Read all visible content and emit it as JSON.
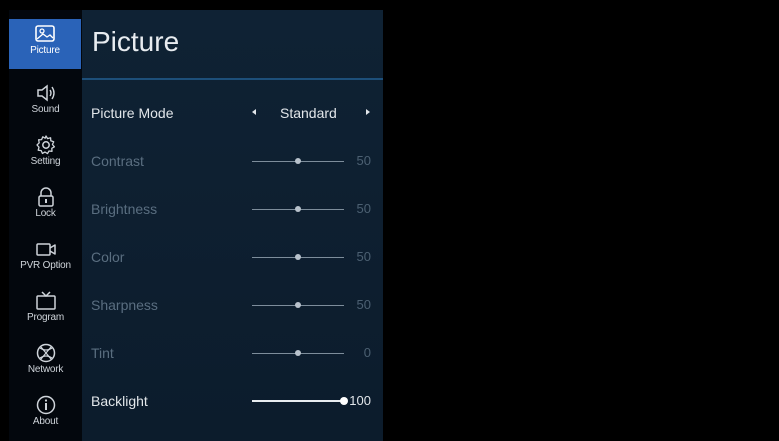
{
  "sidebar": {
    "items": [
      {
        "label": "Picture",
        "icon": "picture-icon",
        "active": true
      },
      {
        "label": "Sound",
        "icon": "speaker-icon",
        "active": false
      },
      {
        "label": "Setting",
        "icon": "gear-icon",
        "active": false
      },
      {
        "label": "Lock",
        "icon": "lock-icon",
        "active": false
      },
      {
        "label": "PVR Option",
        "icon": "video-camera-icon",
        "active": false
      },
      {
        "label": "Program",
        "icon": "tv-icon",
        "active": false
      },
      {
        "label": "Network",
        "icon": "globe-icon",
        "active": false
      },
      {
        "label": "About",
        "icon": "info-icon",
        "active": false
      }
    ]
  },
  "menu": {
    "title": "Picture",
    "picture_mode": {
      "label": "Picture Mode",
      "value": "Standard"
    },
    "sliders": [
      {
        "label": "Contrast",
        "value": "50",
        "fraction": 0.5,
        "enabled": false
      },
      {
        "label": "Brightness",
        "value": "50",
        "fraction": 0.5,
        "enabled": false
      },
      {
        "label": "Color",
        "value": "50",
        "fraction": 0.5,
        "enabled": false
      },
      {
        "label": "Sharpness",
        "value": "50",
        "fraction": 0.5,
        "enabled": false
      },
      {
        "label": "Tint",
        "value": "0",
        "fraction": 0.5,
        "enabled": false
      },
      {
        "label": "Backlight",
        "value": "100",
        "fraction": 1.0,
        "enabled": true
      }
    ]
  },
  "colors": {
    "active_tab": "#2a63b8",
    "panel": "#0f2234",
    "divider": "#1d4f7a"
  }
}
